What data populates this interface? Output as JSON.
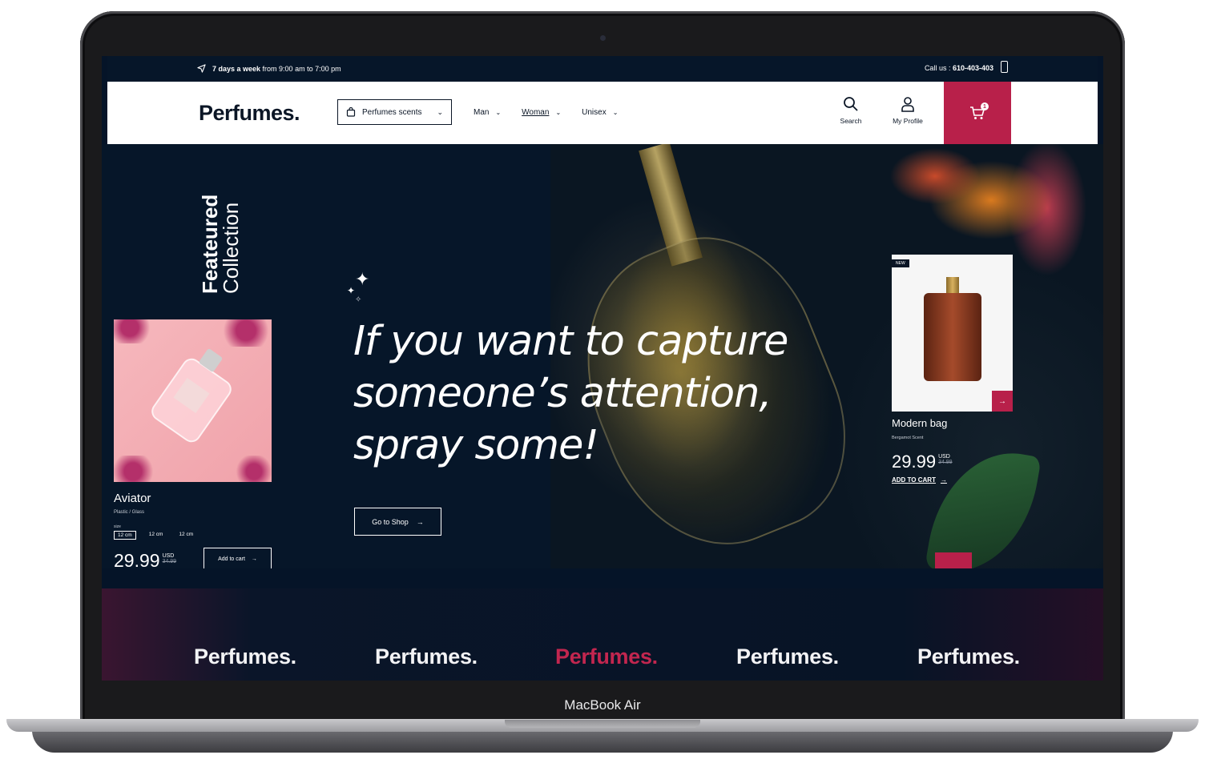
{
  "device": {
    "label": "MacBook Air"
  },
  "topbar": {
    "hours_bold": "7 days a week",
    "hours_rest": " from 9:00 am to 7:00 pm",
    "call_label": "Call us : ",
    "call_number": "610-403-403"
  },
  "navbar": {
    "logo": "Perfumes.",
    "scents_button": "Perfumes scents",
    "menu": [
      {
        "label": "Man"
      },
      {
        "label": "Woman"
      },
      {
        "label": "Unisex"
      }
    ],
    "search_label": "Search",
    "profile_label": "My Profile",
    "cart_count": "1"
  },
  "hero": {
    "featured_word1": "Feateured",
    "featured_word2": "Collection",
    "headline_line1": "If you want to capture",
    "headline_line2": "someone’s attention,",
    "headline_line3": "spray some!",
    "cta": "Go to Shop",
    "left_product": {
      "name": "Aviator",
      "material": "Plastic / Glass",
      "size_label": "size",
      "sizes": [
        "12 cm",
        "12 cm",
        "12 cm"
      ],
      "price": "29.99",
      "currency": "USD",
      "old_price": "34.99",
      "add_button": "Add to cart"
    },
    "right_product": {
      "badge": "NEW",
      "name": "Modern bag",
      "scent": "Bergamot Scent",
      "price": "29.99",
      "currency": "USD",
      "old_price": "34.99",
      "add_link": "ADD TO CART"
    }
  },
  "marquee": {
    "items": [
      "Perfumes.",
      "Perfumes.",
      "Perfumes.",
      "Perfumes.",
      "Perfumes."
    ]
  },
  "colors": {
    "accent": "#b8204a",
    "navy": "#061629"
  }
}
